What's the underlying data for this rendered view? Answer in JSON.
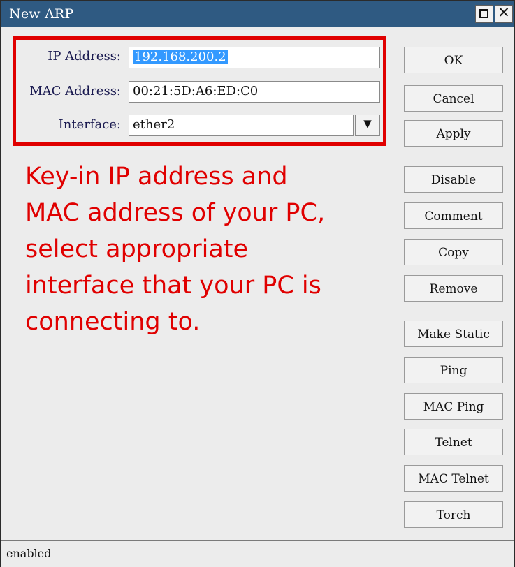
{
  "window": {
    "title": "New ARP"
  },
  "form": {
    "ip_label": "IP Address:",
    "ip_value": "192.168.200.2",
    "mac_label": "MAC Address:",
    "mac_value": "00:21:5D:A6:ED:C0",
    "interface_label": "Interface:",
    "interface_value": "ether2"
  },
  "annotation": {
    "lines": [
      "Key-in IP address and",
      "MAC address of your PC,",
      "select  appropriate",
      "interface that your PC is",
      "connecting to."
    ]
  },
  "buttons": [
    "OK",
    "Cancel",
    "Apply",
    "Disable",
    "Comment",
    "Copy",
    "Remove",
    "Make Static",
    "Ping",
    "MAC Ping",
    "Telnet",
    "MAC Telnet",
    "Torch"
  ],
  "status": {
    "text": "enabled"
  },
  "colors": {
    "titlebar": "#2f5a82",
    "highlight": "#e00000",
    "annotation": "#e00000",
    "selection": "#3399ff"
  },
  "icons": {
    "maximize": "maximize-icon",
    "close": "close-icon",
    "dropdown": "dropdown-arrow-icon"
  }
}
